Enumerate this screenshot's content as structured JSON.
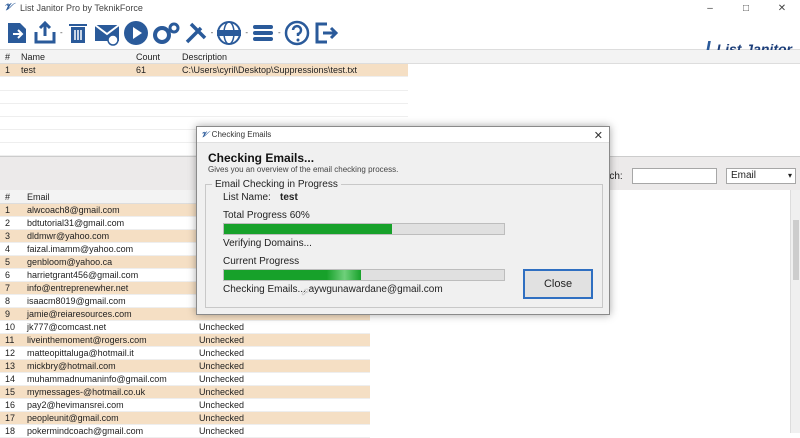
{
  "app": {
    "title": "List Janitor Pro by TeknikForce",
    "logo_text": "List Janitor",
    "logo_initial": "L"
  },
  "window": {
    "minimize": "–",
    "maximize": "□",
    "close": "✕"
  },
  "toolbar": {
    "items": [
      {
        "name": "import-icon"
      },
      {
        "name": "export-icon"
      },
      {
        "name": "delete-icon"
      },
      {
        "name": "email-check-icon"
      },
      {
        "name": "play-icon"
      },
      {
        "name": "settings-icon"
      },
      {
        "name": "tools-icon"
      },
      {
        "name": "web-icon"
      },
      {
        "name": "list-icon"
      },
      {
        "name": "help-icon"
      },
      {
        "name": "exit-icon"
      }
    ],
    "dropdown_marker": "-"
  },
  "lists_grid": {
    "columns": [
      "#",
      "Name",
      "Count",
      "Description"
    ],
    "rows": [
      {
        "num": "1",
        "name": "test",
        "count": "61",
        "description": "C:\\Users\\cyril\\Desktop\\Suppressions\\test.txt"
      }
    ]
  },
  "search": {
    "label": "rch:",
    "field_option": "Email"
  },
  "emails_grid": {
    "columns": [
      "#",
      "Email"
    ],
    "rows": [
      {
        "num": "1",
        "email": "alwcoach8@gmail.com",
        "status": ""
      },
      {
        "num": "2",
        "email": "bdtutorial31@gmail.com",
        "status": ""
      },
      {
        "num": "3",
        "email": "dldmwr@yahoo.com",
        "status": ""
      },
      {
        "num": "4",
        "email": "faizal.imamm@yahoo.com",
        "status": ""
      },
      {
        "num": "5",
        "email": "genbloom@yahoo.ca",
        "status": ""
      },
      {
        "num": "6",
        "email": "harrietgrant456@gmail.com",
        "status": ""
      },
      {
        "num": "7",
        "email": "info@entreprenewher.net",
        "status": ""
      },
      {
        "num": "8",
        "email": "isaacm8019@gmail.com",
        "status": ""
      },
      {
        "num": "9",
        "email": "jamie@reiaresources.com",
        "status": ""
      },
      {
        "num": "10",
        "email": "jk777@comcast.net",
        "status": "Unchecked"
      },
      {
        "num": "11",
        "email": "liveinthemoment@rogers.com",
        "status": "Unchecked"
      },
      {
        "num": "12",
        "email": "matteopittaluga@hotmail.it",
        "status": "Unchecked"
      },
      {
        "num": "13",
        "email": "mickbry@hotmail.com",
        "status": "Unchecked"
      },
      {
        "num": "14",
        "email": "muhammadnumaninfo@gmail.com",
        "status": "Unchecked"
      },
      {
        "num": "15",
        "email": "mymessages-@hotmail.co.uk",
        "status": "Unchecked"
      },
      {
        "num": "16",
        "email": "pay2@hevimansrei.com",
        "status": "Unchecked"
      },
      {
        "num": "17",
        "email": "peopleunit@gmail.com",
        "status": "Unchecked"
      },
      {
        "num": "18",
        "email": "pokermindcoach@gmail.com",
        "status": "Unchecked"
      }
    ]
  },
  "dialog": {
    "title": "Checking Emails",
    "heading": "Checking Emails...",
    "subheading": "Gives you an overview of the email checking process.",
    "group_label": "Email Checking in Progress",
    "list_name_label": "List Name:",
    "list_name_value": "test",
    "total_progress_label": "Total Progress 60%",
    "total_progress": 0.6,
    "total_status": "Verifying Domains...",
    "current_progress_label": "Current Progress",
    "current_progress": 0.49,
    "current_status": "Checking Emails... aywgunawardane@gmail.com",
    "close_button": "Close",
    "close_x": "✕"
  },
  "colors": {
    "progress_green": "#17a12a",
    "row_highlight": "#f5dfc4",
    "dialog_bg": "#f0f0f0",
    "focus_border": "#2f6fc1"
  }
}
